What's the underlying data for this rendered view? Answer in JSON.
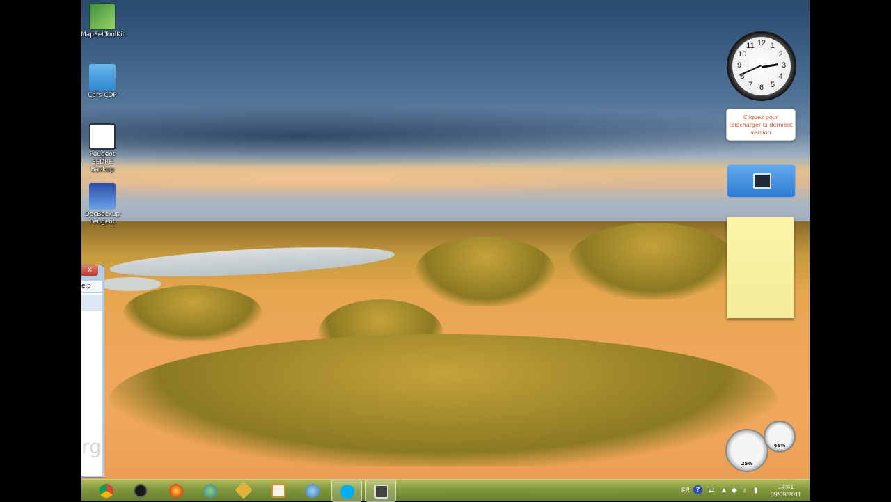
{
  "desktop_icons": [
    {
      "label": "MapSetToolKit",
      "icon": "mapset-icon"
    },
    {
      "label": "Cars CDP",
      "icon": "car-icon"
    },
    {
      "label": "Peugeot SEDRE Backup",
      "icon": "sedre-icon"
    },
    {
      "label": "DocBackup Peugeot",
      "icon": "peugeot-lion-icon"
    }
  ],
  "partial_window": {
    "close_glyph": "x",
    "menu_fragment": "elp",
    "watermark_fragment": "rg"
  },
  "clock": {
    "numbers": [
      "12",
      "1",
      "2",
      "3",
      "4",
      "5",
      "6",
      "7",
      "8",
      "9",
      "10",
      "11"
    ],
    "hour": 2,
    "minute": 41
  },
  "update_gadget": {
    "text": "Cliquez pour télécharger la dernière version"
  },
  "meter_gadget": {
    "cpu": "25%",
    "memory": "46%"
  },
  "taskbar": {
    "apps": [
      {
        "name": "chrome",
        "icon": "chrome-icon"
      },
      {
        "name": "headset",
        "icon": "headset-icon"
      },
      {
        "name": "firefox",
        "icon": "firefox-icon"
      },
      {
        "name": "messenger",
        "icon": "messenger-icon"
      },
      {
        "name": "tool",
        "icon": "wrench-icon"
      },
      {
        "name": "media-player",
        "icon": "play-icon"
      },
      {
        "name": "paint",
        "icon": "paint-icon"
      },
      {
        "name": "skype",
        "icon": "skype-icon"
      },
      {
        "name": "video",
        "icon": "camera-icon"
      }
    ],
    "tray": {
      "language": "FR",
      "help": "?",
      "time": "14:41",
      "date": "09/09/2011"
    }
  }
}
